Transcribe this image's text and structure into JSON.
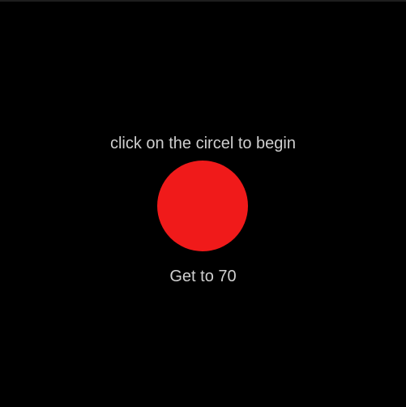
{
  "game": {
    "instruction": "click on the circel to begin",
    "goal": "Get to 70",
    "circle_color": "#f01a1a",
    "background_color": "#000000",
    "text_color": "#cfcfcf"
  }
}
